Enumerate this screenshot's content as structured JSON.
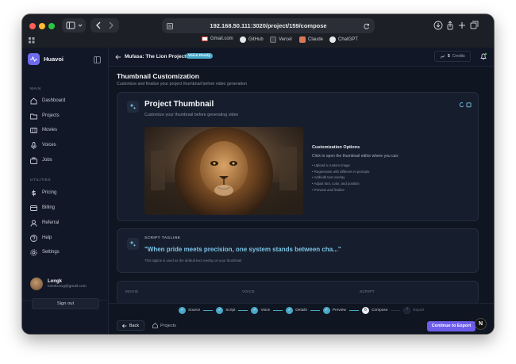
{
  "browser": {
    "url": "192.168.50.111:3020/project/159/compose",
    "bookmarks": [
      {
        "label": "Gmail.com",
        "icon": "gmail-icon"
      },
      {
        "label": "GitHub",
        "icon": "github-icon"
      },
      {
        "label": "Vercel",
        "icon": "vercel-icon"
      },
      {
        "label": "Claude",
        "icon": "claude-icon"
      },
      {
        "label": "ChatGPT",
        "icon": "chatgpt-icon"
      }
    ]
  },
  "sidebar": {
    "brand": "Huavoi",
    "main_label": "MAIN",
    "main_items": [
      {
        "label": "Dashboard",
        "icon": "dashboard-icon"
      },
      {
        "label": "Projects",
        "icon": "folder-icon"
      },
      {
        "label": "Movies",
        "icon": "film-icon"
      },
      {
        "label": "Voices",
        "icon": "mic-icon"
      },
      {
        "label": "Jobs",
        "icon": "jobs-icon"
      }
    ],
    "utilities_label": "UTILITIES",
    "utility_items": [
      {
        "label": "Pricing",
        "icon": "dollar-icon"
      },
      {
        "label": "Billing",
        "icon": "card-icon"
      },
      {
        "label": "Referral",
        "icon": "user-icon"
      },
      {
        "label": "Help",
        "icon": "help-icon"
      },
      {
        "label": "Settings",
        "icon": "gear-icon"
      }
    ],
    "user": {
      "name": "Longk",
      "email": "lonnkcong@gmail.com"
    },
    "signout": "Sign out"
  },
  "topbar": {
    "project_title": "Mufasa: The Lion Project",
    "voice_badge": "Voice Ready",
    "credits_value": "5",
    "credits_label": "Credits"
  },
  "main": {
    "title": "Thumbnail Customization",
    "subtitle": "Customize and finalize your project thumbnail before video generation",
    "thumbnail_card": {
      "title": "Project Thumbnail",
      "subtitle": "Customize your thumbnail before generating video",
      "options_title": "Customization Options",
      "options_intro": "Click to open the thumbnail editor where you can:",
      "options": [
        "• Upload a custom image",
        "• Regenerate with different AI prompts",
        "• Add/edit text overlay",
        "• Adjust font, color, and position",
        "• Preview and finalize"
      ]
    },
    "tagline_card": {
      "label": "SCRIPT TAGLINE",
      "tagline": "\"When pride meets precision, one system stands between cha...\"",
      "note": "This tagline is used as the default text overlay on your thumbnail"
    },
    "columns": [
      "MOVIE",
      "VOICE",
      "SCRIPT"
    ]
  },
  "footer": {
    "steps": [
      {
        "label": "Source",
        "state": "done",
        "marker": "✓"
      },
      {
        "label": "Script",
        "state": "done",
        "marker": "✓"
      },
      {
        "label": "Voice",
        "state": "done",
        "marker": "✓"
      },
      {
        "label": "Details",
        "state": "done",
        "marker": "✓"
      },
      {
        "label": "Preview",
        "state": "done",
        "marker": "✓"
      },
      {
        "label": "Compose",
        "state": "active",
        "marker": "6"
      },
      {
        "label": "Export",
        "state": "pending",
        "marker": "7"
      }
    ],
    "back": "Back",
    "projects": "Projects",
    "continue": "Continue to Export",
    "n_badge": "N"
  },
  "colors": {
    "accent": "#6d5dea",
    "teal": "#4aa8c8",
    "bg": "#0f1521",
    "card": "#161e2d"
  }
}
